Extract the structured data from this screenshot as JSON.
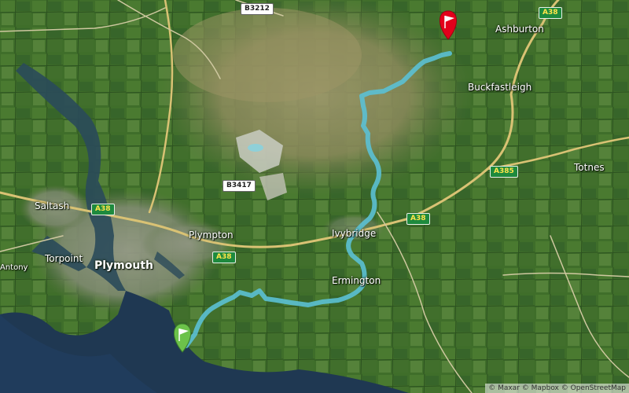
{
  "map": {
    "places": [
      {
        "id": "ashburton",
        "label": "Ashburton",
        "kind": "town"
      },
      {
        "id": "buckfastleigh",
        "label": "Buckfastleigh",
        "kind": "town"
      },
      {
        "id": "totnes",
        "label": "Totnes",
        "kind": "town"
      },
      {
        "id": "saltash",
        "label": "Saltash",
        "kind": "town"
      },
      {
        "id": "plympton",
        "label": "Plympton",
        "kind": "town"
      },
      {
        "id": "ivybridge",
        "label": "Ivybridge",
        "kind": "town"
      },
      {
        "id": "plymouth",
        "label": "Plymouth",
        "kind": "city"
      },
      {
        "id": "torpoint",
        "label": "Torpoint",
        "kind": "town"
      },
      {
        "id": "antony",
        "label": "Antony",
        "kind": "small"
      },
      {
        "id": "ermington",
        "label": "Ermington",
        "kind": "town"
      }
    ],
    "road_shields": [
      {
        "id": "b3212",
        "label": "B3212",
        "style": "b"
      },
      {
        "id": "a38-ne",
        "label": "A38",
        "style": "a"
      },
      {
        "id": "a385",
        "label": "A385",
        "style": "a"
      },
      {
        "id": "b3417",
        "label": "B3417",
        "style": "b"
      },
      {
        "id": "a38-saltash",
        "label": "A38",
        "style": "a"
      },
      {
        "id": "a38-ivybridge",
        "label": "A38",
        "style": "a"
      },
      {
        "id": "a38-plympton",
        "label": "A38",
        "style": "a"
      }
    ],
    "markers": {
      "start_color": "#6cc24a",
      "end_color": "#e3001b",
      "route_color": "#5bc0d4"
    },
    "attribution": "© Maxar © Mapbox © OpenStreetMap"
  }
}
